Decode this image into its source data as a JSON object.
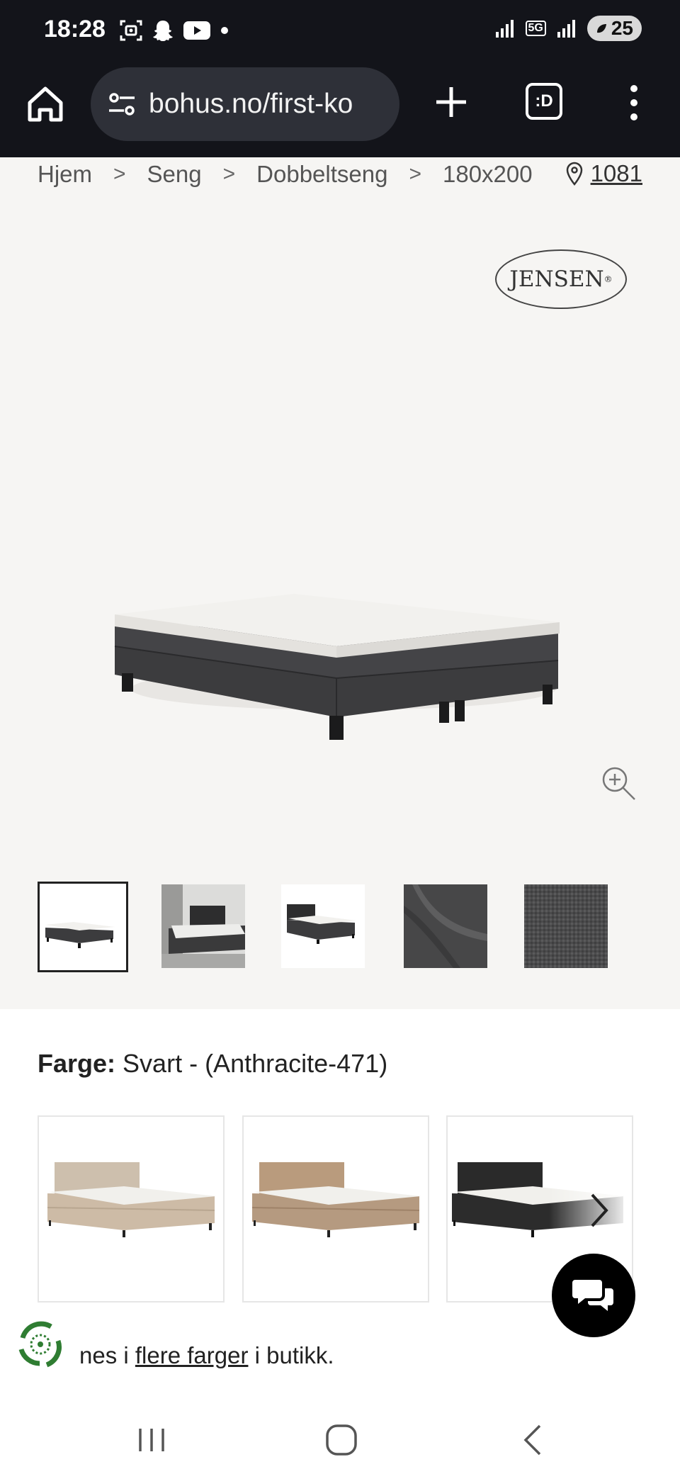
{
  "status_bar": {
    "time": "18:28",
    "network": "5G",
    "battery": "25"
  },
  "browser": {
    "url": "bohus.no/first-ko",
    "tabs_label": ":D"
  },
  "breadcrumb": {
    "items": [
      "Hjem",
      "Seng",
      "Dobbeltseng",
      "180x200"
    ],
    "separator": ">"
  },
  "store": {
    "code": "1081"
  },
  "product": {
    "brand": "JENSEN",
    "brand_mark": "®",
    "color_label": "Farge:",
    "color_value": "Svart - (Anthracite-471)",
    "swatches": [
      {
        "name": "beige",
        "frame": "#cdbfad",
        "base": "#cdbba6"
      },
      {
        "name": "brown",
        "frame": "#b99b7d",
        "base": "#b59a80"
      },
      {
        "name": "black",
        "frame": "#2a2a2a",
        "base": "#2c2c2c"
      }
    ]
  },
  "more_colors": {
    "prefix": "nes i ",
    "link": "flere farger",
    "suffix": " i butikk."
  },
  "colors": {
    "top_bar": "#13141a",
    "gallery_bg": "#f6f5f3",
    "fabric": "#3c3c3e",
    "mattress": "#f2f1ee"
  }
}
